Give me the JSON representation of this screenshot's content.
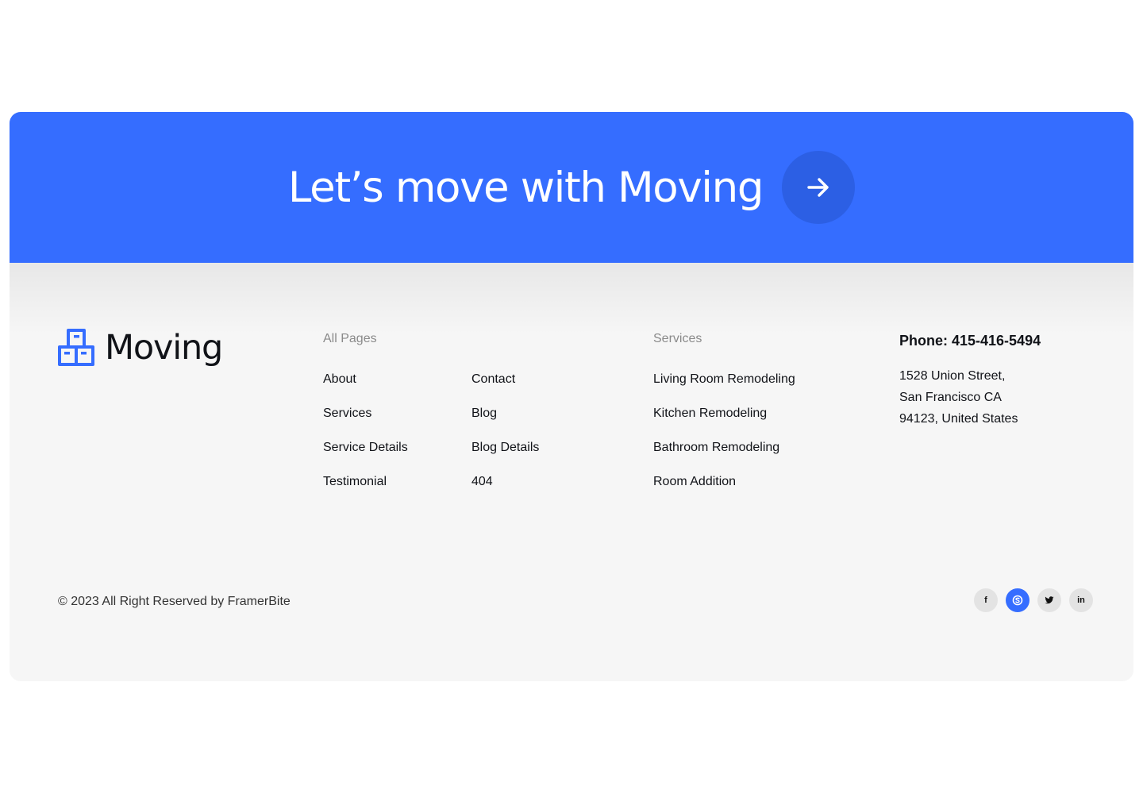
{
  "cta": {
    "title": "Let’s move with Moving",
    "button_icon": "arrow-right-icon"
  },
  "brand": {
    "name": "Moving",
    "logo_icon": "boxes-icon",
    "accent_color": "#356dff"
  },
  "footer": {
    "all_pages": {
      "heading": "All Pages",
      "col1": [
        "About",
        "Services",
        "Service Details",
        "Testimonial"
      ],
      "col2": [
        "Contact",
        "Blog",
        "Blog Details",
        "404"
      ]
    },
    "services": {
      "heading": "Services",
      "items": [
        "Living Room Remodeling",
        "Kitchen Remodeling",
        "Bathroom Remodeling",
        "Room Addition"
      ]
    },
    "contact": {
      "phone": "Phone: 415-416-5494",
      "address": [
        "1528 Union Street,",
        "San Francisco CA",
        "94123, United States"
      ]
    },
    "copyright": "© 2023 All Right Reserved by FramerBite",
    "social": [
      {
        "name": "facebook-icon",
        "glyph": "f"
      },
      {
        "name": "skype-icon",
        "glyph": "S"
      },
      {
        "name": "twitter-icon",
        "glyph": ""
      },
      {
        "name": "linkedin-icon",
        "glyph": "in"
      }
    ]
  }
}
